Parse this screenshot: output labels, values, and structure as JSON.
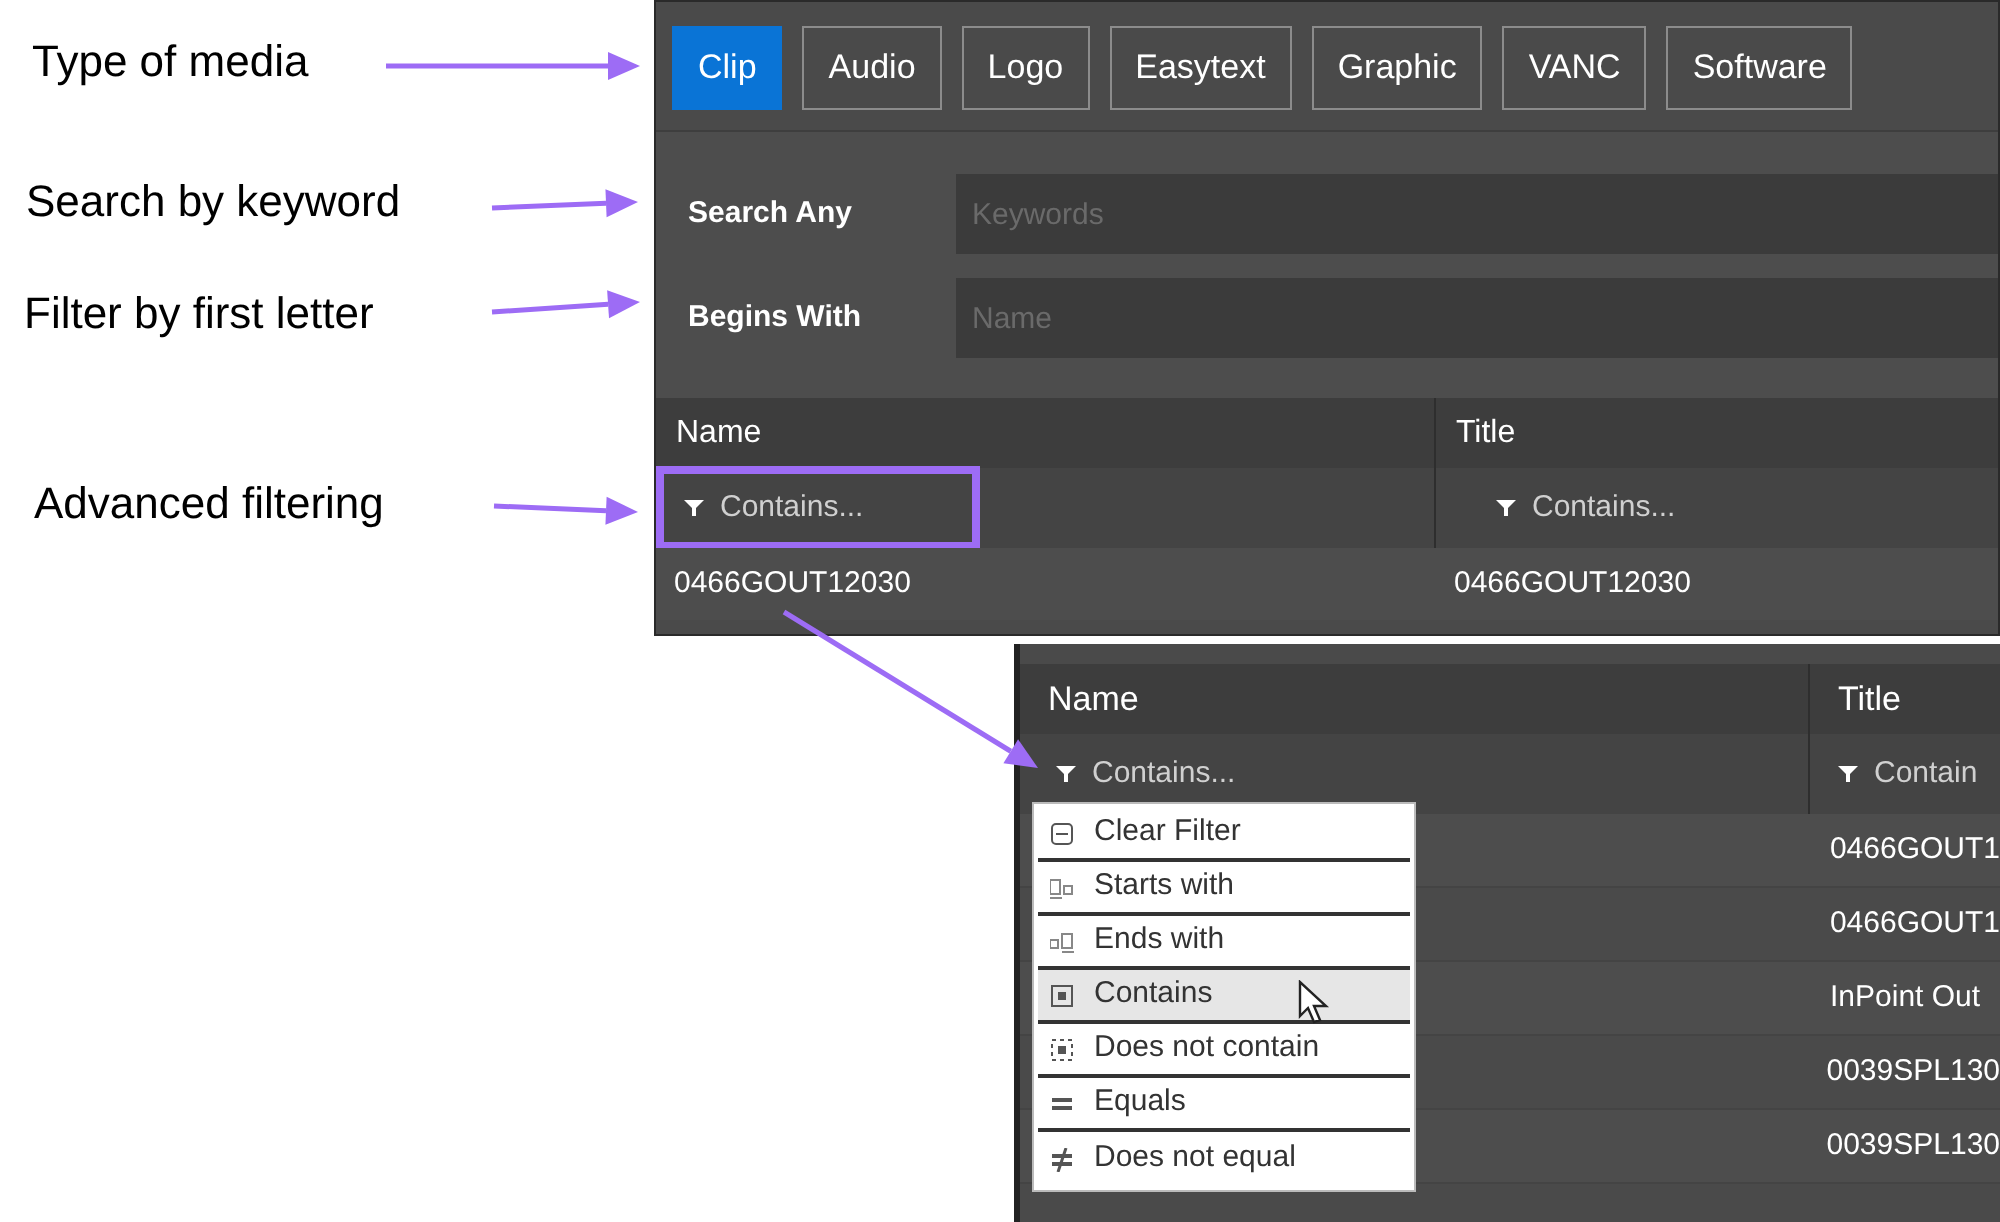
{
  "annotations": [
    {
      "label": "Type of media"
    },
    {
      "label": "Search by keyword"
    },
    {
      "label": "Filter by first letter"
    },
    {
      "label": "Advanced filtering"
    }
  ],
  "media_browser": {
    "tabs": [
      {
        "label": "Clip",
        "selected": true
      },
      {
        "label": "Audio",
        "selected": false
      },
      {
        "label": "Logo",
        "selected": false
      },
      {
        "label": "Easytext",
        "selected": false
      },
      {
        "label": "Graphic",
        "selected": false
      },
      {
        "label": "VANC",
        "selected": false
      },
      {
        "label": "Software",
        "selected": false
      }
    ],
    "search_fields": [
      {
        "label": "Search Any",
        "placeholder": "Keywords"
      },
      {
        "label": "Begins With",
        "placeholder": "Name"
      }
    ],
    "columns": [
      {
        "name": "Name",
        "filter": "Contains...",
        "highlighted": true
      },
      {
        "name": "Title",
        "filter": "Contains...",
        "highlighted": false
      }
    ],
    "rows": [
      [
        "0466GOUT12030",
        "0466GOUT12030"
      ]
    ]
  },
  "filter_detail": {
    "columns": [
      {
        "name": "Name",
        "filter": "Contains..."
      },
      {
        "name": "Title",
        "filter": "Contain"
      }
    ],
    "rows": [
      [
        "0466GOUT1"
      ],
      [
        "0466GOUT1"
      ],
      [
        "InPoint Out"
      ],
      [
        "0039SPL130"
      ],
      [
        "0039SPL130"
      ]
    ],
    "filter_menu": [
      {
        "label": "Clear Filter",
        "kind": "clear",
        "selected": false
      },
      {
        "label": "Starts with",
        "kind": "starts",
        "selected": false
      },
      {
        "label": "Ends with",
        "kind": "ends",
        "selected": false
      },
      {
        "label": "Contains",
        "kind": "contains",
        "selected": true
      },
      {
        "label": "Does not contain",
        "kind": "notcontains",
        "selected": false
      },
      {
        "label": "Equals",
        "kind": "equals",
        "selected": false
      },
      {
        "label": "Does not equal",
        "kind": "notequal",
        "selected": false
      }
    ]
  }
}
